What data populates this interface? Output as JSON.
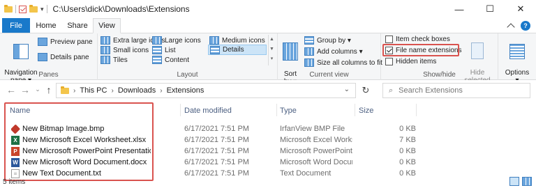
{
  "window": {
    "title_path": "C:\\Users\\dick\\Downloads\\Extensions",
    "minimize": "—",
    "maximize": "☐",
    "close": "✕"
  },
  "tabs": [
    {
      "label": "File"
    },
    {
      "label": "Home"
    },
    {
      "label": "Share"
    },
    {
      "label": "View"
    }
  ],
  "ribbon": {
    "panes": {
      "group_label": "Panes",
      "navigation_pane": "Navigation\npane ▾",
      "preview_pane": "Preview pane",
      "details_pane": "Details pane"
    },
    "layout": {
      "group_label": "Layout",
      "options": [
        "Extra large icons",
        "Large icons",
        "Medium icons",
        "Small icons",
        "List",
        "Details",
        "Tiles",
        "Content"
      ],
      "selected": "Details"
    },
    "current_view": {
      "group_label": "Current view",
      "sort_by": "Sort\nby ▾",
      "group_by": "Group by ▾",
      "add_columns": "Add columns ▾",
      "size_all_columns": "Size all columns to fit"
    },
    "show_hide": {
      "group_label": "Show/hide",
      "item_check_boxes": "Item check boxes",
      "file_name_extensions": "File name extensions",
      "hidden_items": "Hidden items",
      "hide_selected_items": "Hide selected\nitems",
      "item_check_boxes_checked": false,
      "file_name_extensions_checked": true,
      "hidden_items_checked": false
    },
    "options": {
      "label": "Options\n▾"
    }
  },
  "address": {
    "crumbs": [
      "This PC",
      "Downloads",
      "Extensions"
    ],
    "search_placeholder": "Search Extensions"
  },
  "columns": {
    "name": "Name",
    "date": "Date modified",
    "type": "Type",
    "size": "Size"
  },
  "files": [
    {
      "name": "New Bitmap Image.bmp",
      "date": "6/17/2021 7:51 PM",
      "type": "IrfanView BMP File",
      "size": "0 KB",
      "icon": "bmp-icon"
    },
    {
      "name": "New Microsoft Excel Worksheet.xlsx",
      "date": "6/17/2021 7:51 PM",
      "type": "Microsoft Excel Worksh...",
      "size": "7 KB",
      "icon": "excel-icon"
    },
    {
      "name": "New Microsoft PowerPoint Presentation.pptx",
      "date": "6/17/2021 7:51 PM",
      "type": "Microsoft PowerPoint P...",
      "size": "0 KB",
      "icon": "powerpoint-icon"
    },
    {
      "name": "New Microsoft Word Document.docx",
      "date": "6/17/2021 7:51 PM",
      "type": "Microsoft Word Docum...",
      "size": "0 KB",
      "icon": "word-icon"
    },
    {
      "name": "New Text Document.txt",
      "date": "6/17/2021 7:51 PM",
      "type": "Text Document",
      "size": "0 KB",
      "icon": "text-file-icon"
    }
  ],
  "status": {
    "items": "5 items"
  },
  "colors": {
    "file_tab": "#1979ca",
    "highlight": "#d9534f",
    "column_header": "#4d6082"
  }
}
